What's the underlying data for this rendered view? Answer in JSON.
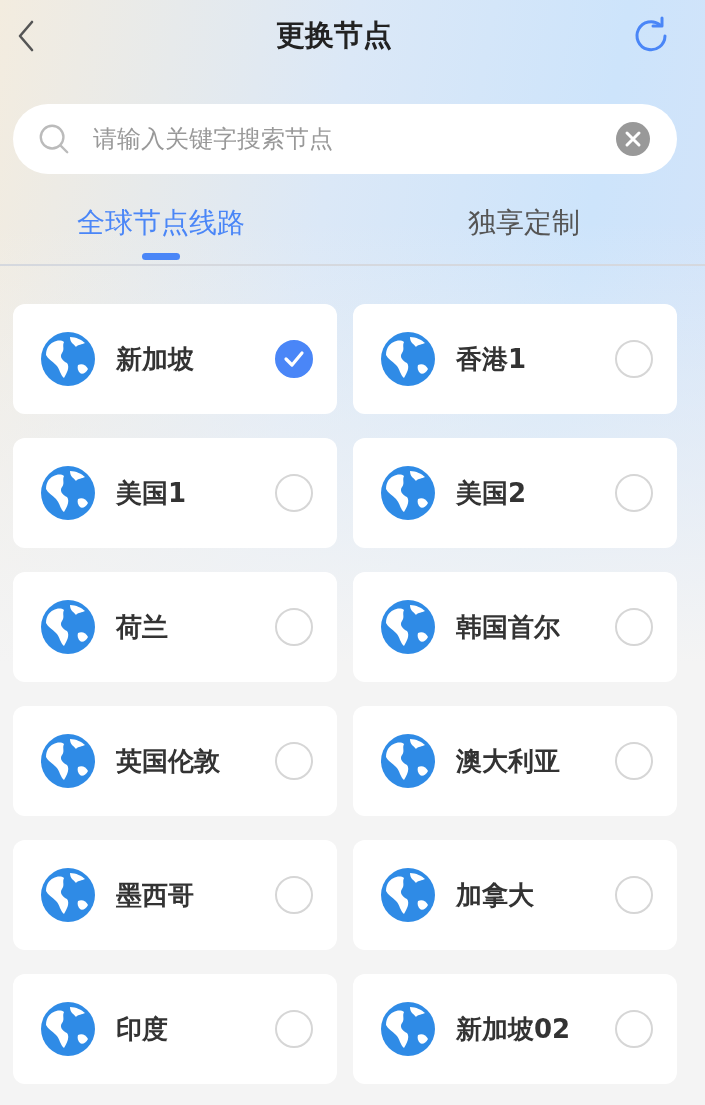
{
  "header": {
    "title": "更换节点"
  },
  "search": {
    "placeholder": "请输入关键字搜索节点"
  },
  "tabs": [
    {
      "label": "全球节点线路",
      "selected": true
    },
    {
      "label": "独享定制",
      "selected": false
    }
  ],
  "nodes": [
    {
      "name": "新加坡",
      "selected": true
    },
    {
      "name": "香港1",
      "selected": false
    },
    {
      "name": "美国1",
      "selected": false
    },
    {
      "name": "美国2",
      "selected": false
    },
    {
      "name": "荷兰",
      "selected": false
    },
    {
      "name": "韩国首尔",
      "selected": false
    },
    {
      "name": "英国伦敦",
      "selected": false
    },
    {
      "name": "澳大利亚",
      "selected": false
    },
    {
      "name": "墨西哥",
      "selected": false
    },
    {
      "name": "加拿大",
      "selected": false
    },
    {
      "name": "印度",
      "selected": false
    },
    {
      "name": "新加坡02",
      "selected": false
    }
  ]
}
